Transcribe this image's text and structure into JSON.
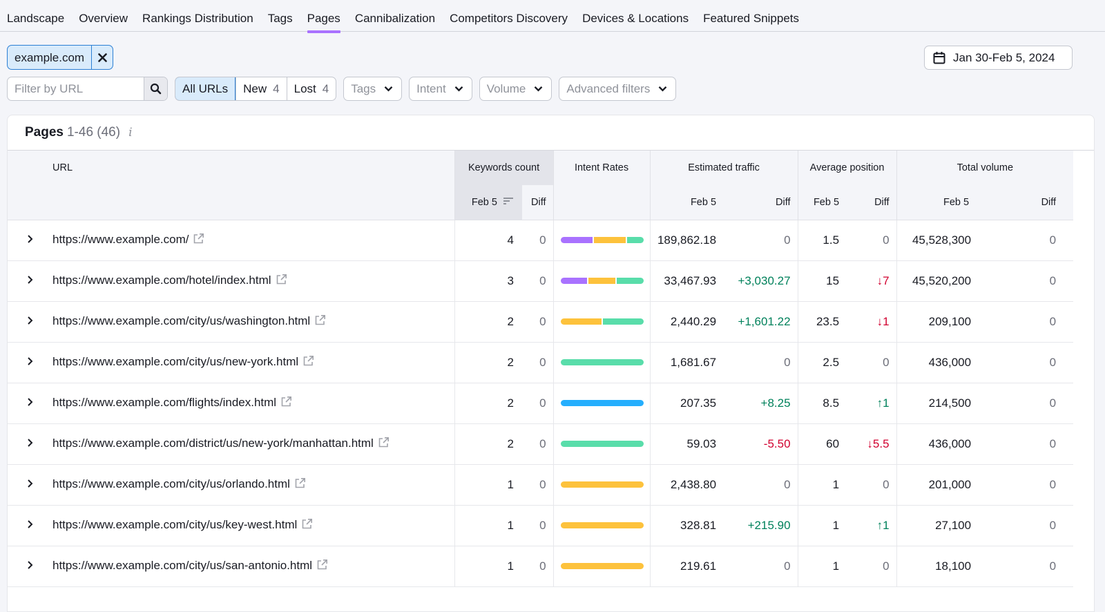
{
  "tabs": [
    {
      "label": "Landscape",
      "active": false
    },
    {
      "label": "Overview",
      "active": false
    },
    {
      "label": "Rankings Distribution",
      "active": false
    },
    {
      "label": "Tags",
      "active": false
    },
    {
      "label": "Pages",
      "active": true
    },
    {
      "label": "Cannibalization",
      "active": false
    },
    {
      "label": "Competitors Discovery",
      "active": false
    },
    {
      "label": "Devices & Locations",
      "active": false
    },
    {
      "label": "Featured Snippets",
      "active": false
    }
  ],
  "domain_chip": {
    "label": "example.com",
    "close_icon": "close-icon"
  },
  "date_range": {
    "label": "Jan 30-Feb 5, 2024",
    "icon": "calendar-icon"
  },
  "filters": {
    "url_placeholder": "Filter by URL",
    "url_value": "",
    "segments": [
      {
        "label": "All URLs",
        "count": "",
        "active": true
      },
      {
        "label": "New",
        "count": "4",
        "active": false
      },
      {
        "label": "Lost",
        "count": "4",
        "active": false
      }
    ],
    "dropdowns": [
      "Tags",
      "Intent",
      "Volume",
      "Advanced filters"
    ]
  },
  "card": {
    "title": "Pages",
    "range": "1-46 (46)",
    "info_icon": "i"
  },
  "columns": {
    "url": "URL",
    "keywords_count": "Keywords count",
    "intent_rates": "Intent Rates",
    "estimated_traffic": "Estimated traffic",
    "average_position": "Average position",
    "total_volume": "Total volume",
    "date": "Feb 5",
    "diff": "Diff"
  },
  "intent_colors": {
    "informational": "#a972ff",
    "navigational": "#25aefd",
    "commercial": "#fdc23c",
    "transactional": "#59ddaa"
  },
  "colors": {
    "accent": "#a972ff",
    "positive": "#00815b",
    "negative": "#d1002f",
    "selected_bg": "#d9ebfb",
    "selected_border": "#2b7fd4"
  },
  "rows": [
    {
      "url": "https://www.example.com/",
      "kw": "4",
      "kw_diff": "0",
      "intent": [
        {
          "type": "informational",
          "share": 0.4
        },
        {
          "type": "commercial",
          "share": 0.4
        },
        {
          "type": "transactional",
          "share": 0.2
        }
      ],
      "traffic": "189,862.18",
      "traffic_diff": "0",
      "traffic_dir": "none",
      "pos": "1.5",
      "pos_diff": "0",
      "pos_dir": "none",
      "vol": "45,528,300",
      "vol_diff": "0"
    },
    {
      "url": "https://www.example.com/hotel/index.html",
      "kw": "3",
      "kw_diff": "0",
      "intent": [
        {
          "type": "informational",
          "share": 0.333
        },
        {
          "type": "commercial",
          "share": 0.333
        },
        {
          "type": "transactional",
          "share": 0.334
        }
      ],
      "traffic": "33,467.93",
      "traffic_diff": "+3,030.27",
      "traffic_dir": "up",
      "pos": "15",
      "pos_diff": "↓7",
      "pos_dir": "down",
      "vol": "45,520,200",
      "vol_diff": "0"
    },
    {
      "url": "https://www.example.com/city/us/washington.html",
      "kw": "2",
      "kw_diff": "0",
      "intent": [
        {
          "type": "commercial",
          "share": 0.5
        },
        {
          "type": "transactional",
          "share": 0.5
        }
      ],
      "traffic": "2,440.29",
      "traffic_diff": "+1,601.22",
      "traffic_dir": "up",
      "pos": "23.5",
      "pos_diff": "↓1",
      "pos_dir": "down",
      "vol": "209,100",
      "vol_diff": "0"
    },
    {
      "url": "https://www.example.com/city/us/new-york.html",
      "kw": "2",
      "kw_diff": "0",
      "intent": [
        {
          "type": "transactional",
          "share": 1
        }
      ],
      "traffic": "1,681.67",
      "traffic_diff": "0",
      "traffic_dir": "none",
      "pos": "2.5",
      "pos_diff": "0",
      "pos_dir": "none",
      "vol": "436,000",
      "vol_diff": "0"
    },
    {
      "url": "https://www.example.com/flights/index.html",
      "kw": "2",
      "kw_diff": "0",
      "intent": [
        {
          "type": "navigational",
          "share": 1
        }
      ],
      "traffic": "207.35",
      "traffic_diff": "+8.25",
      "traffic_dir": "up",
      "pos": "8.5",
      "pos_diff": "↑1",
      "pos_dir": "up",
      "vol": "214,500",
      "vol_diff": "0"
    },
    {
      "url": "https://www.example.com/district/us/new-york/manhattan.html",
      "kw": "2",
      "kw_diff": "0",
      "intent": [
        {
          "type": "transactional",
          "share": 1
        }
      ],
      "traffic": "59.03",
      "traffic_diff": "-5.50",
      "traffic_dir": "down",
      "pos": "60",
      "pos_diff": "↓5.5",
      "pos_dir": "down",
      "vol": "436,000",
      "vol_diff": "0"
    },
    {
      "url": "https://www.example.com/city/us/orlando.html",
      "kw": "1",
      "kw_diff": "0",
      "intent": [
        {
          "type": "commercial",
          "share": 1
        }
      ],
      "traffic": "2,438.80",
      "traffic_diff": "0",
      "traffic_dir": "none",
      "pos": "1",
      "pos_diff": "0",
      "pos_dir": "none",
      "vol": "201,000",
      "vol_diff": "0"
    },
    {
      "url": "https://www.example.com/city/us/key-west.html",
      "kw": "1",
      "kw_diff": "0",
      "intent": [
        {
          "type": "commercial",
          "share": 1
        }
      ],
      "traffic": "328.81",
      "traffic_diff": "+215.90",
      "traffic_dir": "up",
      "pos": "1",
      "pos_diff": "↑1",
      "pos_dir": "up",
      "vol": "27,100",
      "vol_diff": "0"
    },
    {
      "url": "https://www.example.com/city/us/san-antonio.html",
      "kw": "1",
      "kw_diff": "0",
      "intent": [
        {
          "type": "commercial",
          "share": 1
        }
      ],
      "traffic": "219.61",
      "traffic_diff": "0",
      "traffic_dir": "none",
      "pos": "1",
      "pos_diff": "0",
      "pos_dir": "none",
      "vol": "18,100",
      "vol_diff": "0"
    }
  ]
}
